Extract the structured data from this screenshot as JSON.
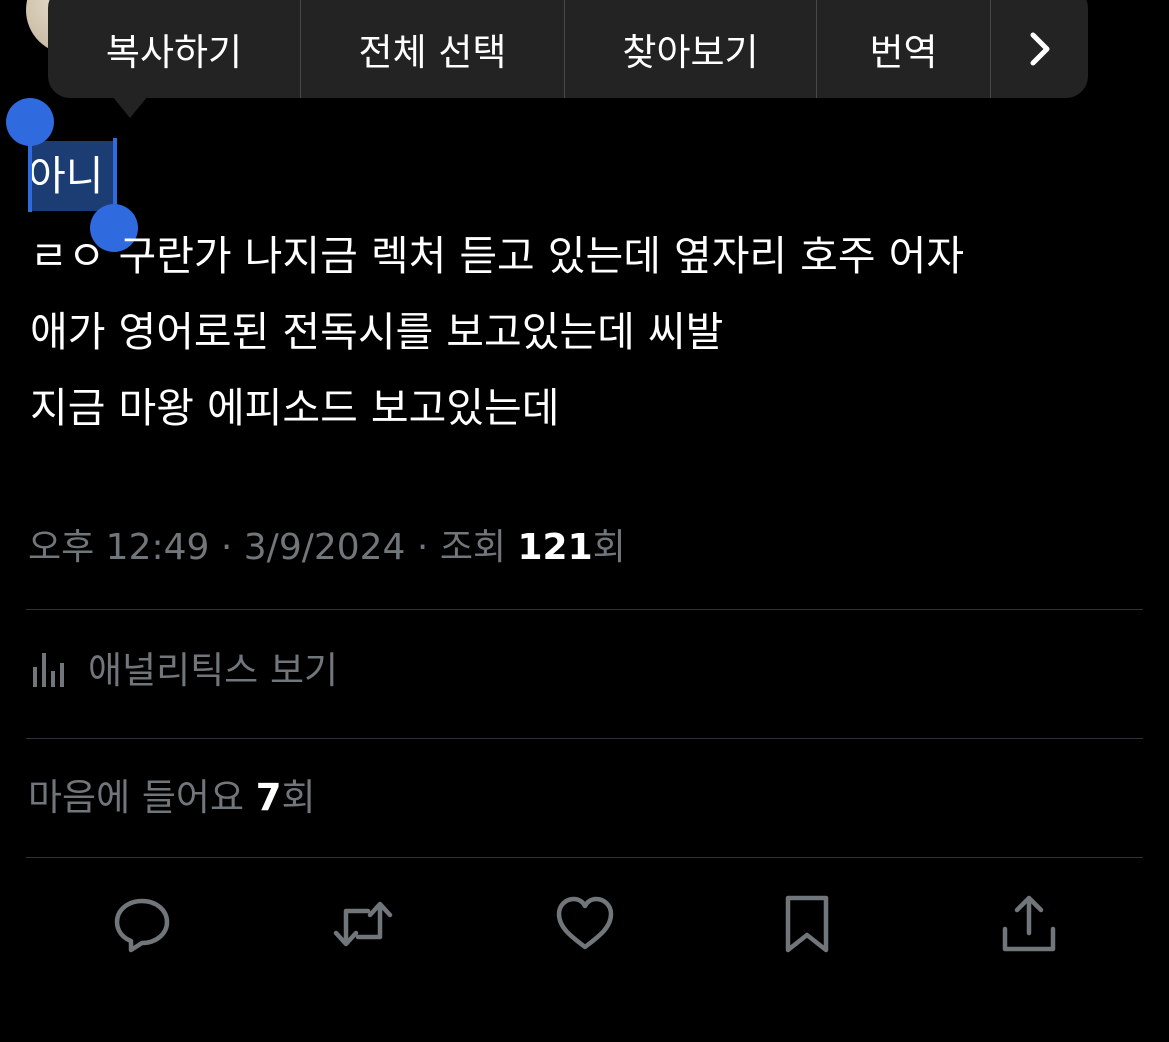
{
  "edit_menu": {
    "copy": "복사하기",
    "select_all": "전체 선택",
    "look_up": "찾아보기",
    "translate": "번역",
    "more_icon": "chevron-right-icon"
  },
  "post": {
    "selected_text": "아니",
    "lines": [
      "ㄹㅇ 구란가 나지금 렉처 듣고 있는데 옆자리 호주 어자",
      "애가 영어로된 전독시를 보고있는데 씨발",
      "지금 마왕 에피소드 보고있는데"
    ]
  },
  "meta": {
    "time": "오후 12:49",
    "sep": " · ",
    "date": "3/9/2024",
    "views_prefix": "조회 ",
    "views_count": "121",
    "views_suffix": "회"
  },
  "analytics": {
    "icon": "analytics-bars-icon",
    "label": "애널리틱스 보기"
  },
  "likes": {
    "prefix": "마음에 들어요 ",
    "count": "7",
    "suffix": "회"
  },
  "actions": [
    "reply-icon",
    "retweet-icon",
    "like-icon",
    "bookmark-icon",
    "share-icon"
  ],
  "colors": {
    "background": "#000000",
    "menu": "#232324",
    "selection": "#2f6bde",
    "muted": "#71767b",
    "divider": "#2f3336"
  }
}
